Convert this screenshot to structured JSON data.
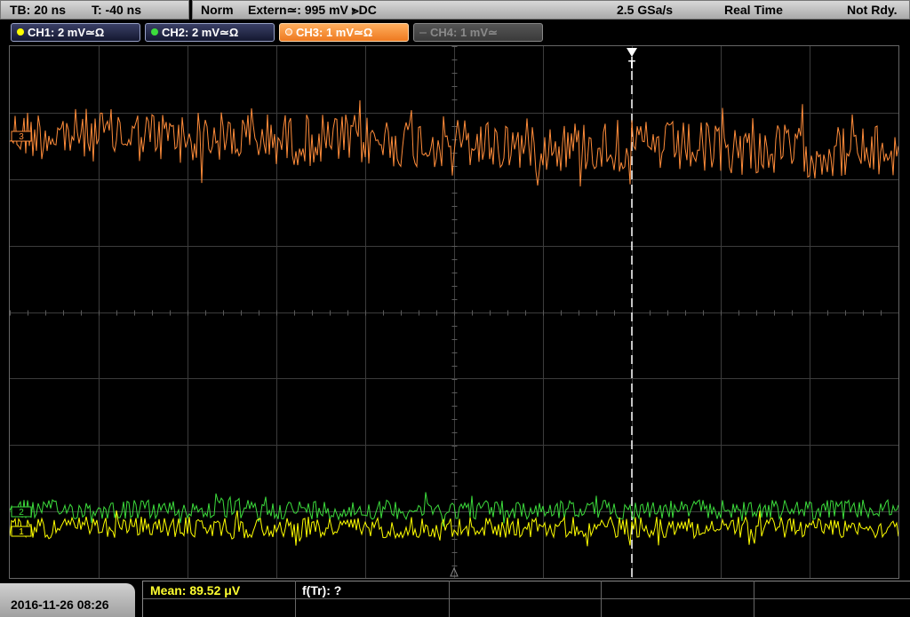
{
  "timebase": {
    "tb": "TB: 20 ns",
    "trig_offset": "T: -40 ns"
  },
  "status": {
    "mode": "Norm",
    "trigger": "Extern≃: 995 mV ⪢DC",
    "sample_rate": "2.5 GSa/s",
    "acq_mode": "Real Time",
    "state": "Not Rdy."
  },
  "channels": [
    {
      "label": "CH1: 2 mV≃Ω",
      "color": "#ffff00",
      "state": "on"
    },
    {
      "label": "CH2: 2 mV≃Ω",
      "color": "#3cdc3c",
      "state": "on"
    },
    {
      "label": "CH3: 1 mV≃Ω",
      "color": "#ff8c3a",
      "state": "selected"
    },
    {
      "label": "CH4: 1 mV≃",
      "color": "#8a8a8a",
      "state": "off"
    }
  ],
  "display": {
    "trigger_marker": "T",
    "ch3_marker": "3",
    "ch2_marker": "2",
    "ch1_marker": "1"
  },
  "footer": {
    "datetime": "2016-11-26 08:26",
    "meas1": "Mean: 89.52 μV",
    "meas2": "f(Tr): ?"
  }
}
